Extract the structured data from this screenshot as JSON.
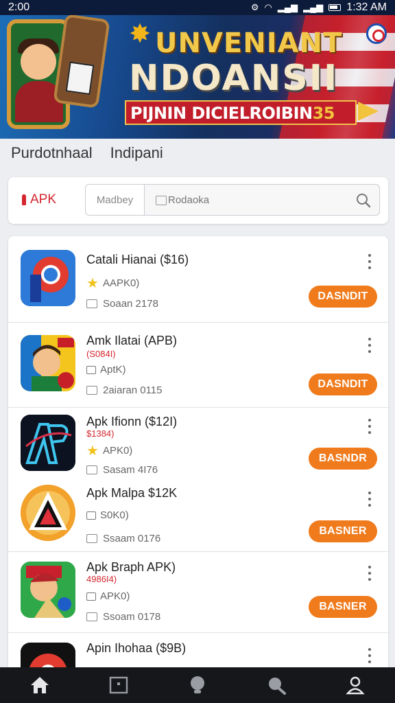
{
  "status_bar": {
    "time": "2:00",
    "right_time": "1:32 AM"
  },
  "banner": {
    "title_line1": "UNVENIANT",
    "title_line2": "NDOANSII",
    "ribbon_text": "PIJNIN DICIELROIBIN",
    "ribbon_number": "35"
  },
  "page_header": {
    "title": "Purdotnhaal",
    "subtitle": "Indipani"
  },
  "search": {
    "filter_label": "APK",
    "sort_label": "Madbey",
    "placeholder": "Rodaoka"
  },
  "items": [
    {
      "name": "Catali Hianai ($16)",
      "price": "",
      "rating": "AAPK0)",
      "date": "Soaan 2178",
      "button": "DASNDIT",
      "icon": "chrome-like-icon"
    },
    {
      "name": "Amk Ilatai (APB)",
      "price": "(S084I)",
      "rating": "AptK)",
      "date": "2aiaran 0115",
      "button": "DASNDIT",
      "icon": "cartoon-face-icon"
    },
    {
      "name": "Apk Ifionn ($12I)",
      "price": "$1384)",
      "rating": "APK0)",
      "date": "Sasam 4I76",
      "button": "BASNDR",
      "icon": "ap-logo-icon"
    },
    {
      "name": "Apk Malpa $12K",
      "price": "",
      "rating": "S0K0)",
      "date": "Ssaam 0176",
      "button": "BASNER",
      "icon": "triangle-logo-icon"
    },
    {
      "name": "Apk Braph APK)",
      "price": "4986I4)",
      "rating": "APK0)",
      "date": "Ssoam 0178",
      "button": "BASNER",
      "icon": "cartoon-game-icon"
    },
    {
      "name": "Apin Ihohaa ($9B)",
      "price": "",
      "rating": "",
      "date": "",
      "button": "",
      "icon": "chrome-icon"
    }
  ],
  "colors": {
    "accent": "#f07b1c",
    "price": "#d3262e",
    "nav_bg": "#15171b"
  }
}
